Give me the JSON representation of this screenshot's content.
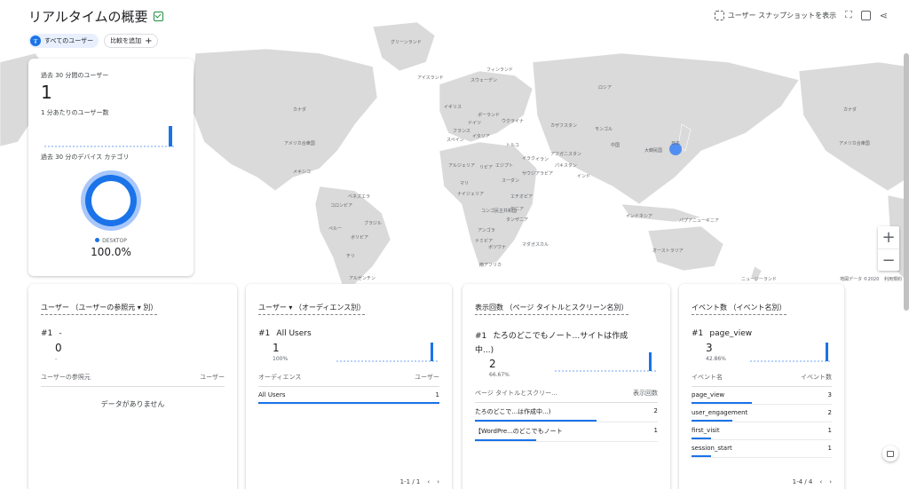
{
  "header": {
    "title": "リアルタイムの概要",
    "segment_avatar": "す",
    "segment_label": "すべてのユーザー",
    "add_compare_label": "比較を追加",
    "snapshot_label": "ユーザー スナップショットを表示"
  },
  "map": {
    "attribution": "地図データ ©2020",
    "terms": "利用規約",
    "zoom_in": "+",
    "zoom_out": "−",
    "labels": [
      "カナダ",
      "アメリカ合衆国",
      "メキシコ",
      "ベネズエラ",
      "コロンビア",
      "ブラジル",
      "ペルー",
      "ボリビア",
      "チリ",
      "アルゼンチン",
      "グリーンランド",
      "アイスランド",
      "ノルウェー",
      "スウェーデン",
      "フィンランド",
      "イギリス",
      "ドイツ",
      "フランス",
      "スペイン",
      "イタリア",
      "ポーランド",
      "ウクライナ",
      "トルコ",
      "エジプト",
      "リビア",
      "アルジェリア",
      "マリ",
      "ニジェール",
      "チャド",
      "スーダン",
      "ナイジェリア",
      "エチオピア",
      "ケニア",
      "タンザニア",
      "コンゴ民主共和国",
      "アンゴラ",
      "ナミビア",
      "ボツワナ",
      "南アフリカ",
      "マダガスカル",
      "ロシア",
      "カザフスタン",
      "モンゴル",
      "中国",
      "インド",
      "イラン",
      "イラク",
      "サウジアラビア",
      "パキスタン",
      "アフガニスタン",
      "日本",
      "大韓民国",
      "インドネシア",
      "パプアニューギニア",
      "オーストラリア",
      "ニュージーランド"
    ]
  },
  "summary": {
    "users_label": "過去 30 分間のユーザー",
    "users_value": "1",
    "per_minute_label": "1 分あたりのユーザー数",
    "device_label": "過去 30 分のデバイス カテゴリ",
    "device_legend": "DESKTOP",
    "device_pct": "100.0%"
  },
  "cards": {
    "c1": {
      "title": "ユーザー （ユーザーの参照元 ▾ 別）",
      "rank": "#1",
      "rank_label": "-",
      "value": "0",
      "sub": "-",
      "col1": "ユーザーの参照元",
      "col2": "ユーザー",
      "empty": "データがありません"
    },
    "c2": {
      "title": "ユーザー ▾ （オーディエンス別）",
      "rank": "#1",
      "rank_label": "All Users",
      "value": "1",
      "sub": "100%",
      "col1": "オーディエンス",
      "col2": "ユーザー",
      "rows": [
        {
          "name": "All Users",
          "value": "1"
        }
      ],
      "pager": "1-1 / 1"
    },
    "c3": {
      "title": "表示回数 （ページ タイトルとスクリーン名別）",
      "rank": "#1",
      "rank_label": "たろのどこでもノート...サイトは作成中...)",
      "value": "2",
      "sub": "66.67%",
      "col1": "ページ タイトルとスクリー...",
      "col2": "表示回数",
      "rows": [
        {
          "name": "たろのどこで...は作成中...)",
          "value": "2"
        },
        {
          "name": "【WordPre...のどこでもノート",
          "value": "1"
        }
      ]
    },
    "c4": {
      "title": "イベント数 （イベント名別）",
      "rank": "#1",
      "rank_label": "page_view",
      "value": "3",
      "sub": "42.86%",
      "col1": "イベント名",
      "col2": "イベント数",
      "rows": [
        {
          "name": "page_view",
          "value": "3"
        },
        {
          "name": "user_engagement",
          "value": "2"
        },
        {
          "name": "first_visit",
          "value": "1"
        },
        {
          "name": "session_start",
          "value": "1"
        }
      ],
      "pager": "1-4 / 4"
    }
  },
  "colors": {
    "accent": "#1a73e8",
    "land": "#dcdcdc",
    "dot": "#4285f4"
  }
}
